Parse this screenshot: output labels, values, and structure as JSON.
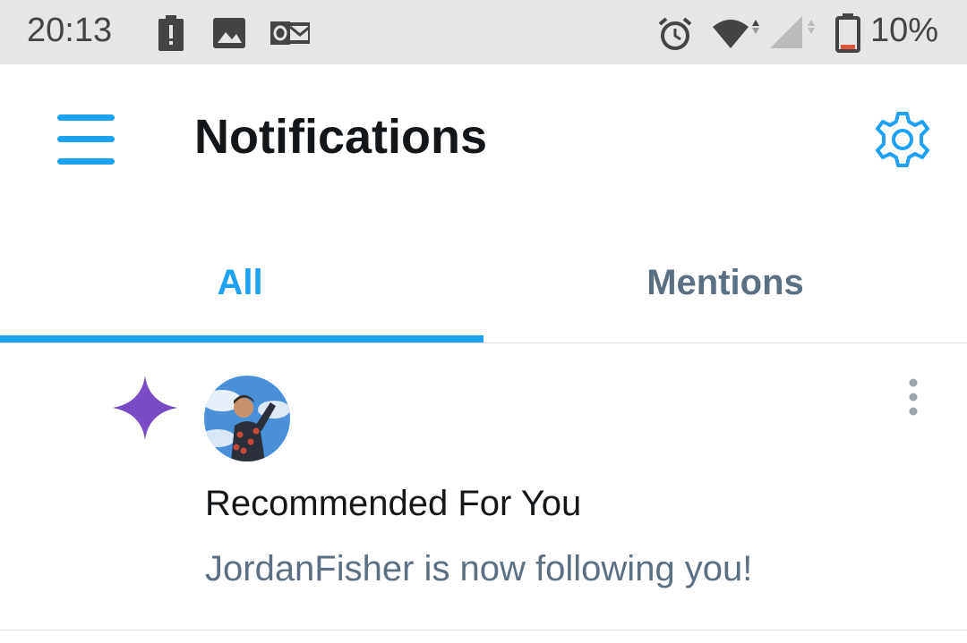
{
  "status_bar": {
    "time": "20:13",
    "battery_percent": "10%",
    "left_icons": [
      "battery-alert-icon",
      "image-icon",
      "outlook-icon"
    ],
    "right_icons": [
      "alarm-icon",
      "wifi-icon",
      "cell-signal-icon",
      "battery-icon"
    ],
    "battery_level": 0.1
  },
  "header": {
    "title": "Notifications",
    "menu_icon": "hamburger-menu-icon",
    "settings_icon": "gear-icon"
  },
  "tabs": [
    {
      "label": "All",
      "selected": true
    },
    {
      "label": "Mentions",
      "selected": false
    }
  ],
  "notifications": [
    {
      "icon": "sparkle-icon",
      "avatar": "user-avatar",
      "title": "Recommended For You",
      "body": "JordanFisher is now following you!",
      "menu_icon": "more-vertical-icon"
    }
  ],
  "colors": {
    "accent": "#1da1f2",
    "secondary_text": "#5b7083",
    "primary_text": "#14171a",
    "sparkle": "#794bc4",
    "battery_low": "#e0533c",
    "status_bar_bg": "#e6e6e6"
  }
}
